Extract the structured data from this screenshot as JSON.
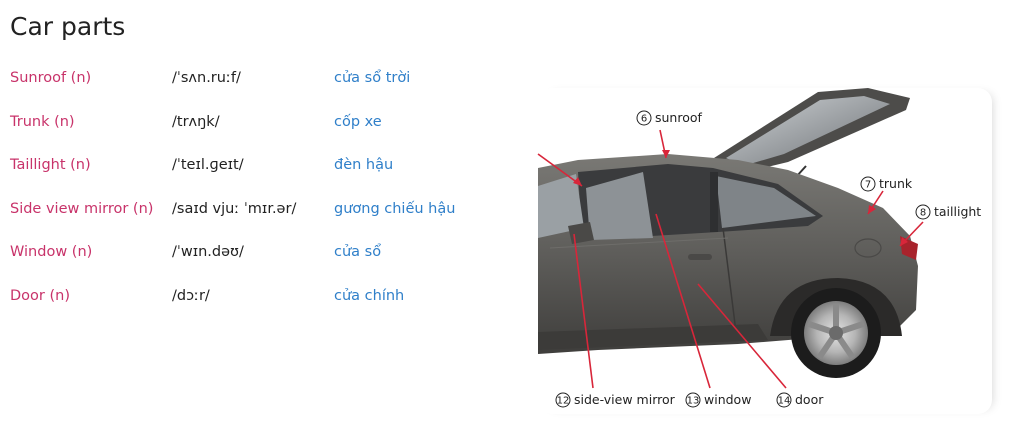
{
  "title": "Car parts",
  "vocab": [
    {
      "term": "Sunroof (n)",
      "ipa": "/ˈsʌn.ruːf/",
      "meaning": "cửa sổ trời"
    },
    {
      "term": "Trunk (n)",
      "ipa": "/trʌŋk/",
      "meaning": "cốp xe"
    },
    {
      "term": "Taillight (n)",
      "ipa": "/ˈteɪl.ɡeɪt/",
      "meaning": "đèn hậu"
    },
    {
      "term": "Side view mirror (n)",
      "ipa": "/saɪd vjuː ˈmɪr.ər/",
      "meaning": "gương chiếu hậu"
    },
    {
      "term": "Window (n)",
      "ipa": "/ˈwɪn.dəʊ/",
      "meaning": "cửa sổ"
    },
    {
      "term": "Door (n)",
      "ipa": "/dɔːr/",
      "meaning": "cửa chính"
    }
  ],
  "diagram": {
    "labels": [
      {
        "num": "6",
        "text": "sunroof"
      },
      {
        "num": "7",
        "text": "trunk"
      },
      {
        "num": "8",
        "text": "taillight"
      },
      {
        "num": "12",
        "text": "side-view mirror"
      },
      {
        "num": "13",
        "text": "window"
      },
      {
        "num": "14",
        "text": "door"
      }
    ]
  },
  "colors": {
    "term": "#c8336a",
    "meaning": "#2f7fc9",
    "pointer": "#d8263a",
    "car_body": "#5e5d5a"
  }
}
